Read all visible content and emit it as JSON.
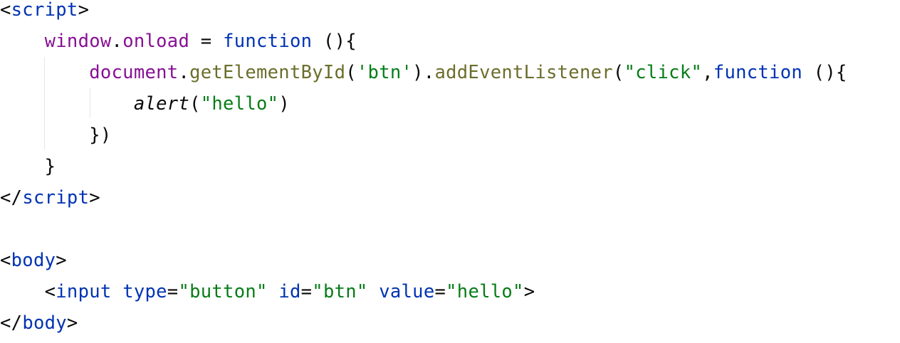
{
  "editor": {
    "lines": [
      [
        {
          "t": "<",
          "c": "punct"
        },
        {
          "t": "script",
          "c": "tag"
        },
        {
          "t": ">",
          "c": "punct"
        }
      ],
      [
        {
          "t": "    ",
          "c": "punct"
        },
        {
          "t": "window",
          "c": "glob"
        },
        {
          "t": ".",
          "c": "punct"
        },
        {
          "t": "onload",
          "c": "glob"
        },
        {
          "t": " = ",
          "c": "punct"
        },
        {
          "t": "function",
          "c": "kw"
        },
        {
          "t": " (){",
          "c": "punct"
        }
      ],
      [
        {
          "t": "        ",
          "c": "punct"
        },
        {
          "t": "document",
          "c": "glob"
        },
        {
          "t": ".",
          "c": "punct"
        },
        {
          "t": "getElementById",
          "c": "fn"
        },
        {
          "t": "(",
          "c": "punct"
        },
        {
          "t": "'btn'",
          "c": "str"
        },
        {
          "t": ").",
          "c": "punct"
        },
        {
          "t": "addEventListener",
          "c": "fn"
        },
        {
          "t": "(",
          "c": "punct"
        },
        {
          "t": "\"click\"",
          "c": "str"
        },
        {
          "t": ",",
          "c": "punct"
        },
        {
          "t": "function",
          "c": "kw"
        },
        {
          "t": " (){",
          "c": "punct"
        }
      ],
      [
        {
          "t": "            ",
          "c": "punct"
        },
        {
          "t": "alert",
          "c": "italic"
        },
        {
          "t": "(",
          "c": "punct"
        },
        {
          "t": "\"hello\"",
          "c": "str"
        },
        {
          "t": ")",
          "c": "punct"
        }
      ],
      [
        {
          "t": "        })",
          "c": "punct"
        }
      ],
      [
        {
          "t": "    }",
          "c": "punct"
        }
      ],
      [
        {
          "t": "</",
          "c": "punct"
        },
        {
          "t": "script",
          "c": "tag"
        },
        {
          "t": ">",
          "c": "punct"
        }
      ],
      [],
      [
        {
          "t": "<",
          "c": "punct"
        },
        {
          "t": "body",
          "c": "tag"
        },
        {
          "t": ">",
          "c": "punct"
        }
      ],
      [
        {
          "t": "    <",
          "c": "punct"
        },
        {
          "t": "input",
          "c": "tag"
        },
        {
          "t": " ",
          "c": "punct"
        },
        {
          "t": "type",
          "c": "tag"
        },
        {
          "t": "=",
          "c": "punct"
        },
        {
          "t": "\"button\"",
          "c": "str"
        },
        {
          "t": " ",
          "c": "punct"
        },
        {
          "t": "id",
          "c": "tag"
        },
        {
          "t": "=",
          "c": "punct"
        },
        {
          "t": "\"btn\"",
          "c": "str"
        },
        {
          "t": " ",
          "c": "punct"
        },
        {
          "t": "value",
          "c": "tag"
        },
        {
          "t": "=",
          "c": "punct"
        },
        {
          "t": "\"hello\"",
          "c": "str"
        },
        {
          "t": ">",
          "c": "punct"
        }
      ],
      [
        {
          "t": "</",
          "c": "punct"
        },
        {
          "t": "body",
          "c": "tag"
        },
        {
          "t": ">",
          "c": "punct"
        }
      ]
    ]
  }
}
